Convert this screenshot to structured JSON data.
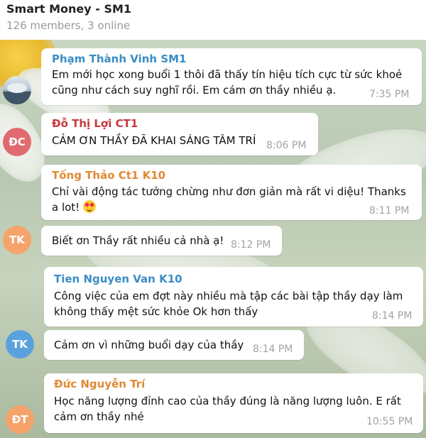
{
  "header": {
    "title": "Smart Money - SM1",
    "subtitle": "126 members, 3 online"
  },
  "messages": [
    {
      "sender": "Phạm Thành Vinh SM1",
      "sender_color": "#3a8dc4",
      "text_1": "Em mới học xong buổi 1 thôi đã thấy tín hiệu tích cực từ sức khoẻ",
      "text_2": "cũng như cách suy nghĩ rồi. Em cám ơn thầy nhiều ạ.",
      "time": "7:35 PM"
    },
    {
      "sender": "Đỗ Thị Lợi CT1",
      "sender_color": "#c8383f",
      "text_1": "CẢM ƠN THẦY ĐÃ  KHAI SÁNG TÂM TRÍ",
      "time": "8:06 PM",
      "avatar_initials": "ĐC",
      "avatar_color": "#e06b6f"
    },
    {
      "sender": "Tống Thảo Ct1 K10",
      "sender_color": "#e08a33",
      "text_1": "Chỉ vài động tác tưởng chừng như đơn giản mà rất vi diệu! Thanks",
      "text_2": "a lot!",
      "emoji": "smiling-face-with-heart-eyes-emoji",
      "time": "8:11 PM"
    },
    {
      "text_1": "Biết ơn Thầy rất nhiều cả nhà ạ!",
      "time": "8:12 PM",
      "avatar_initials": "TK",
      "avatar_color": "#f5a36a"
    },
    {
      "sender": "Tien Nguyen Van K10",
      "sender_color": "#3a8dc4",
      "text_1": "Công việc của em đợt này nhiều mà tập các bài tập thầy dạy làm",
      "text_2": "không thấy mệt sức khỏe Ok hơn thấy",
      "time": "8:14 PM"
    },
    {
      "text_1": "Cảm ơn vì những buổi dạy của thầy",
      "time": "8:14 PM",
      "avatar_initials": "TK",
      "avatar_color": "#5aa2dc"
    },
    {
      "sender": "Đức Nguyễn Trí",
      "sender_color": "#e08a33",
      "text_1": "Học năng lượng đỉnh cao của thầy đúng là năng lượng luôn. E rất",
      "text_2": "cảm ơn thầy nhé",
      "time": "10:55 PM",
      "avatar_initials": "ĐT",
      "avatar_color": "#f5a36a"
    }
  ]
}
